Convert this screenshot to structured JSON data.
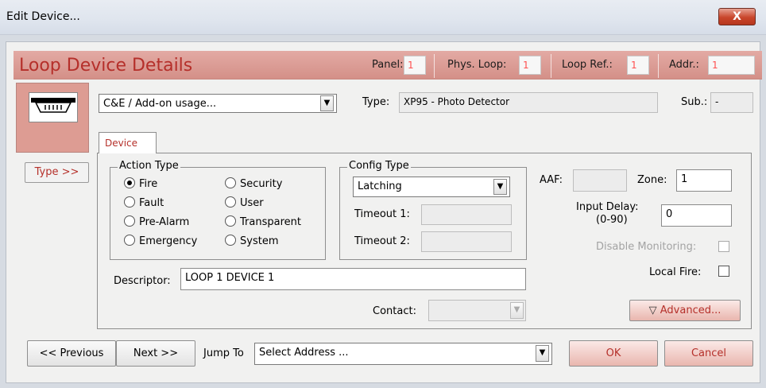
{
  "window": {
    "title": "Edit Device...",
    "close_label": "X"
  },
  "header": {
    "title": "Loop Device Details",
    "panel_label": "Panel:",
    "panel_value": "1",
    "phys_loop_label": "Phys. Loop:",
    "phys_loop_value": "1",
    "loop_ref_label": "Loop Ref.:",
    "loop_ref_value": "1",
    "addr_label": "Addr.:",
    "addr_value": "1"
  },
  "device": {
    "usage_value": "C&E / Add-on usage...",
    "type_label": "Type:",
    "type_value": "XP95 - Photo Detector",
    "sub_label": "Sub.:",
    "sub_value": "-",
    "type_button": "Type >>"
  },
  "tab": {
    "label": "Device"
  },
  "action_type": {
    "title": "Action Type",
    "options": [
      "Fire",
      "Fault",
      "Pre-Alarm",
      "Emergency",
      "Security",
      "User",
      "Transparent",
      "System"
    ],
    "selected": "Fire"
  },
  "config_type": {
    "title": "Config Type",
    "value": "Latching",
    "timeout1_label": "Timeout 1:",
    "timeout2_label": "Timeout 2:"
  },
  "right": {
    "aaf_label": "AAF:",
    "zone_label": "Zone:",
    "zone_value": "1",
    "input_delay_label": "Input Delay:",
    "input_delay_range": "(0-90)",
    "input_delay_value": "0",
    "disable_monitoring_label": "Disable Monitoring:",
    "local_fire_label": "Local Fire:",
    "advanced_label": "Advanced..."
  },
  "descriptor": {
    "label": "Descriptor:",
    "value": "LOOP 1 DEVICE 1"
  },
  "contact": {
    "label": "Contact:"
  },
  "footer": {
    "previous_label": "<< Previous",
    "next_label": "Next >>",
    "jump_to_label": "Jump To",
    "jump_value": "Select Address ...",
    "ok_label": "OK",
    "cancel_label": "Cancel"
  },
  "colors": {
    "accent": "#b52f2a",
    "header_band": "#d49088",
    "field_value_red": "#ff4f4f"
  }
}
